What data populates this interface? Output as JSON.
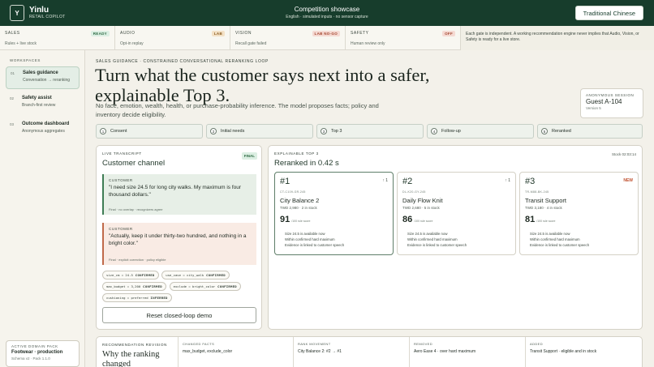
{
  "header": {
    "logo_letter": "Y",
    "brand": "Yinlu",
    "brand_sub": "RETAIL COPILOT",
    "title": "Competition showcase",
    "subtitle": "English · simulated inputs · no sensor capture",
    "language_button": "Traditional Chinese"
  },
  "status": {
    "items": [
      {
        "label": "SALES",
        "desc": "Rules + live stock",
        "badge": "READY",
        "badge_color": "#2f6b44"
      },
      {
        "label": "AUDIO",
        "desc": "Opt-in replay",
        "badge": "LAB",
        "badge_color": "#8a5a1c"
      },
      {
        "label": "VISION",
        "desc": "Recall gate failed",
        "badge": "LAB NO-GO",
        "badge_color": "#a3462f"
      },
      {
        "label": "SAFETY",
        "desc": "Human review only",
        "badge": "OFF",
        "badge_color": "#a3462f"
      }
    ],
    "note": "Each gate is independent. A working recommendation engine never implies that Audio, Vision, or Safety is ready for a live store."
  },
  "sidebar": {
    "section_label": "WORKSPACES",
    "items": [
      {
        "num": "01",
        "title": "Sales guidance",
        "sub": "Conversation → reranking",
        "active": true
      },
      {
        "num": "02",
        "title": "Safety assist",
        "sub": "Branch-first review",
        "active": false
      },
      {
        "num": "03",
        "title": "Outcome dashboard",
        "sub": "Anonymous aggregates",
        "active": false
      }
    ],
    "pack": {
      "label": "ACTIVE DOMAIN PACK",
      "name": "Footwear · production",
      "version": "Schema v2 · Pack 1.1.0"
    }
  },
  "hero": {
    "kicker": "SALES GUIDANCE · CONSTRAINED CONVERSATIONAL RERANKING LOOP",
    "headline": "Turn what the customer says next into a safer, explainable Top 3.",
    "lede": "No face, emotion, wealth, health, or purchase-probability inference. The model proposes facts; policy and inventory decide eligibility.",
    "session_label": "ANONYMOUS SESSION",
    "session_id": "Guest A-104",
    "session_version": "Version 5"
  },
  "steps": [
    {
      "num": "1",
      "label": "Consent"
    },
    {
      "num": "2",
      "label": "Initial needs"
    },
    {
      "num": "3",
      "label": "Top 3"
    },
    {
      "num": "4",
      "label": "Follow-up"
    },
    {
      "num": "5",
      "label": "Reranked"
    }
  ],
  "transcript": {
    "kicker": "LIVE TRANSCRIPT",
    "title": "Customer channel",
    "badge": "FINAL",
    "messages": [
      {
        "who": "CUSTOMER",
        "text": "\"I need size 24.5 for long city walks. My maximum is four thousand dollars.\"",
        "meta": "Final · no overlap · recognizers agree"
      },
      {
        "who": "CUSTOMER",
        "text": "\"Actually, keep it under thirty-two hundred, and nothing in a bright color.\"",
        "meta": "Final · explicit correction · policy eligible"
      }
    ],
    "chips": [
      {
        "fact": "size_cm = 24.5",
        "state": "CONFIRMED"
      },
      {
        "fact": "use_case = city_walk",
        "state": "CONFIRMED"
      },
      {
        "fact": "max_budget = 3,200",
        "state": "CONFIRMED"
      },
      {
        "fact": "exclude = bright_color",
        "state": "CONFIRMED"
      },
      {
        "fact": "cushioning = preferred",
        "state": "INFERRED"
      }
    ],
    "reset_label": "Reset closed-loop demo"
  },
  "top3": {
    "kicker": "EXPLAINABLE TOP 3",
    "title": "Reranked in 0.42 s",
    "stock_time": "Stock 02:03:14",
    "products": [
      {
        "rank": "#1",
        "arrow": "↑ 1",
        "sku": "CT-C109-GR-245",
        "name": "City Balance 2",
        "price": "TWD 2,980 · 2 in stock",
        "score": "91",
        "score_sub": "/100 rule score",
        "reasons": [
          "Size 24.5 is available now",
          "Within confirmed hard maximum",
          "Evidence is linked to customer speech"
        ]
      },
      {
        "rank": "#2",
        "arrow": "↑ 1",
        "sku": "DL-K20-GY-245",
        "name": "Daily Flow Knit",
        "price": "TWD 2,680 · 5 in stock",
        "score": "86",
        "score_sub": "/100 rule score",
        "reasons": [
          "Size 24.5 is available now",
          "Within confirmed hard maximum",
          "Evidence is linked to customer speech"
        ]
      },
      {
        "rank": "#3",
        "arrow": "NEW",
        "sku": "TR-M88-BK-245",
        "name": "Transit Support",
        "price": "TWD 3,180 · 4 in stock",
        "score": "81",
        "score_sub": "/100 rule score",
        "reasons": [
          "Size 24.5 is available now",
          "Within confirmed hard maximum",
          "Evidence is linked to customer speech"
        ]
      }
    ]
  },
  "revision": {
    "kicker": "RECOMMENDATION REVISION",
    "title": "Why the ranking changed",
    "columns": [
      {
        "label": "CHANGED FACTS",
        "value": "max_budget, exclude_color"
      },
      {
        "label": "RANK MOVEMENT",
        "value": "City Balance 2: #2 → #1"
      },
      {
        "label": "REMOVED",
        "value": "Aero Ease 4 · over hard maximum"
      },
      {
        "label": "ADDED",
        "value": "Transit Support · eligible and in stock"
      }
    ]
  }
}
